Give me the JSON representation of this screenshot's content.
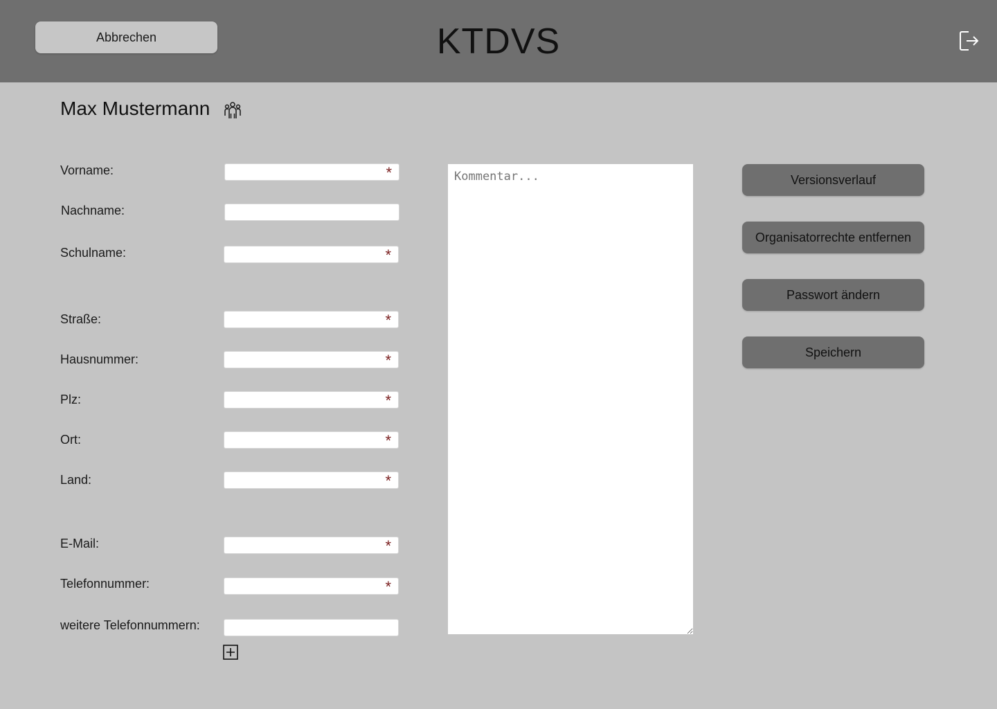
{
  "header": {
    "title": "KTDVS",
    "cancel_label": "Abbrechen",
    "logout_icon": "logout-icon"
  },
  "user": {
    "name": "Max Mustermann",
    "icon": "group-icon"
  },
  "form": {
    "required_marker": "*",
    "fields": [
      {
        "label": "Vorname:",
        "value": "",
        "required": true
      },
      {
        "label": "Nachname:",
        "value": "",
        "required": false
      },
      {
        "label": "Schulname:",
        "value": "",
        "required": true
      },
      {
        "label": "Straße:",
        "value": "",
        "required": true
      },
      {
        "label": "Hausnummer:",
        "value": "",
        "required": true
      },
      {
        "label": "Plz:",
        "value": "",
        "required": true
      },
      {
        "label": "Ort:",
        "value": "",
        "required": true
      },
      {
        "label": "Land:",
        "value": "",
        "required": true
      },
      {
        "label": "E-Mail:",
        "value": "",
        "required": true
      },
      {
        "label": "Telefonnummer:",
        "value": "",
        "required": true
      },
      {
        "label": "weitere Telefonnummern:",
        "value": "",
        "required": false
      }
    ],
    "add_icon": "plus-square-icon"
  },
  "comment": {
    "placeholder": "Kommentar...",
    "value": ""
  },
  "actions": {
    "history_label": "Versionsverlauf",
    "remove_rights_label": "Organisatorrechte entfernen",
    "change_password_label": "Passwort ändern",
    "save_label": "Speichern"
  },
  "colors": {
    "header_bg": "#6f6f6f",
    "page_bg": "#c4c4c4",
    "required_star": "#7a1f1f"
  }
}
